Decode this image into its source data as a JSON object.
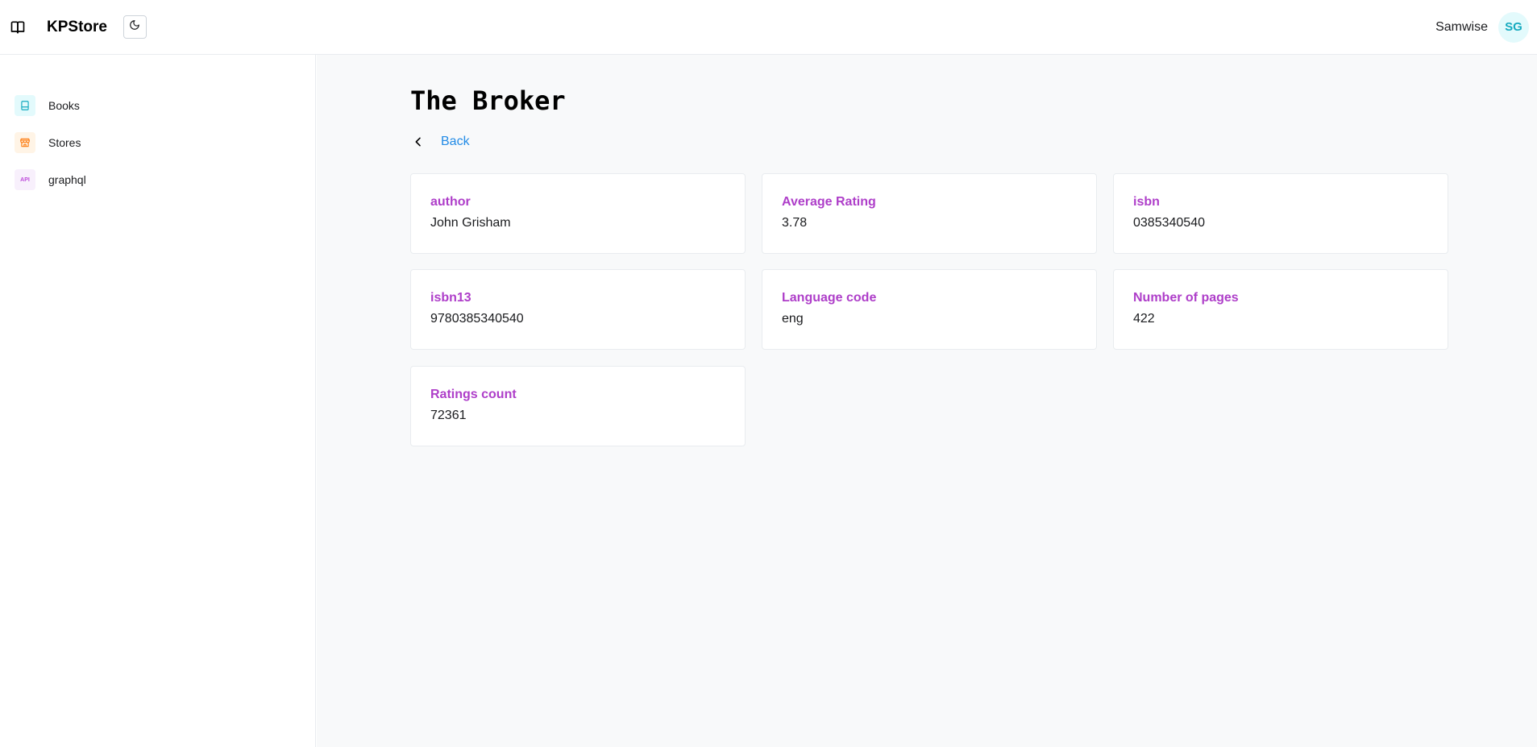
{
  "header": {
    "app_title": "KPStore",
    "logo_icon": "book-open-icon",
    "theme_toggle_icon": "moon-icon",
    "user_name": "Samwise",
    "avatar_initials": "SG"
  },
  "sidebar": {
    "items": [
      {
        "label": "Books",
        "icon": "book-icon",
        "icon_color": "#15aabf"
      },
      {
        "label": "Stores",
        "icon": "store-icon",
        "icon_color": "#fd7e14"
      },
      {
        "label": "graphql",
        "icon": "api-icon",
        "icon_text": "API",
        "icon_color": "#be4bdb"
      }
    ]
  },
  "main": {
    "title": "The Broker",
    "back_label": "Back",
    "fields": [
      {
        "label": "author",
        "value": "John Grisham"
      },
      {
        "label": "Average Rating",
        "value": "3.78"
      },
      {
        "label": "isbn",
        "value": "0385340540"
      },
      {
        "label": "isbn13",
        "value": "9780385340540"
      },
      {
        "label": "Language code",
        "value": "eng"
      },
      {
        "label": "Number of pages",
        "value": "422"
      },
      {
        "label": "Ratings count",
        "value": "72361"
      }
    ]
  },
  "colors": {
    "accent_label": "#ae3ec9",
    "link": "#228be6",
    "avatar_bg": "#e3fafc",
    "avatar_text": "#15aabf"
  }
}
